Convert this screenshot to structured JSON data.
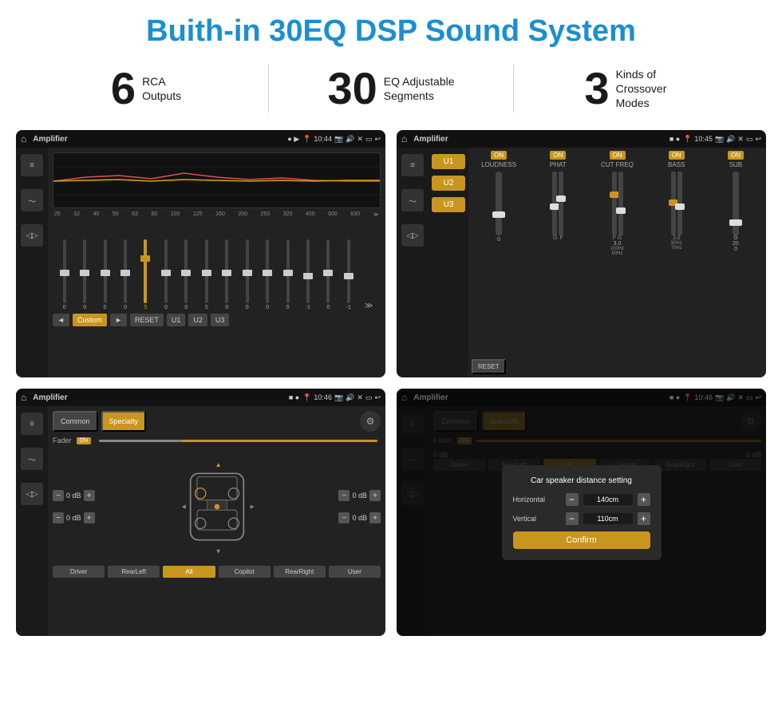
{
  "header": {
    "title": "Buith-in 30EQ DSP Sound System"
  },
  "stats": [
    {
      "number": "6",
      "text": "RCA\nOutputs"
    },
    {
      "number": "30",
      "text": "EQ Adjustable\nSegments"
    },
    {
      "number": "3",
      "text": "Kinds of\nCrossover Modes"
    }
  ],
  "screens": [
    {
      "id": "eq-screen",
      "statusBar": {
        "title": "Amplifier",
        "time": "10:44"
      }
    },
    {
      "id": "crossover-screen",
      "statusBar": {
        "title": "Amplifier",
        "time": "10:45"
      }
    },
    {
      "id": "speaker-screen",
      "statusBar": {
        "title": "Amplifier",
        "time": "10:46"
      }
    },
    {
      "id": "dialog-screen",
      "statusBar": {
        "title": "Amplifier",
        "time": "10:46"
      },
      "dialog": {
        "title": "Car speaker distance setting",
        "horizontal_label": "Horizontal",
        "horizontal_value": "140cm",
        "vertical_label": "Vertical",
        "vertical_value": "110cm",
        "confirm_label": "Confirm"
      }
    }
  ],
  "eq": {
    "freqs": [
      "25",
      "32",
      "40",
      "50",
      "63",
      "80",
      "100",
      "125",
      "160",
      "200",
      "250",
      "320",
      "400",
      "500",
      "630"
    ],
    "values": [
      "0",
      "0",
      "0",
      "0",
      "5",
      "0",
      "0",
      "0",
      "0",
      "0",
      "0",
      "0",
      "-1",
      "0",
      "-1"
    ],
    "preset": "Custom",
    "buttons": [
      "RESET",
      "U1",
      "U2",
      "U3"
    ]
  },
  "crossover": {
    "u_buttons": [
      "U1",
      "U2",
      "U3"
    ],
    "controls": [
      {
        "label": "LOUDNESS",
        "on": true
      },
      {
        "label": "PHAT",
        "on": true
      },
      {
        "label": "CUT FREQ",
        "on": true
      },
      {
        "label": "BASS",
        "on": true
      },
      {
        "label": "SUB",
        "on": true
      }
    ],
    "reset_label": "RESET"
  },
  "speaker": {
    "tabs": [
      "Common",
      "Specialty"
    ],
    "fader_label": "Fader",
    "on_label": "ON",
    "locations": [
      "Driver",
      "RearLeft",
      "All",
      "Copilot",
      "RearRight",
      "User"
    ],
    "db_values": [
      "0 dB",
      "0 dB",
      "0 dB",
      "0 dB"
    ]
  },
  "dialog": {
    "title": "Car speaker distance setting",
    "horizontal_label": "Horizontal",
    "horizontal_value": "140cm",
    "vertical_label": "Vertical",
    "vertical_value": "110cm",
    "confirm_label": "Confirm"
  }
}
